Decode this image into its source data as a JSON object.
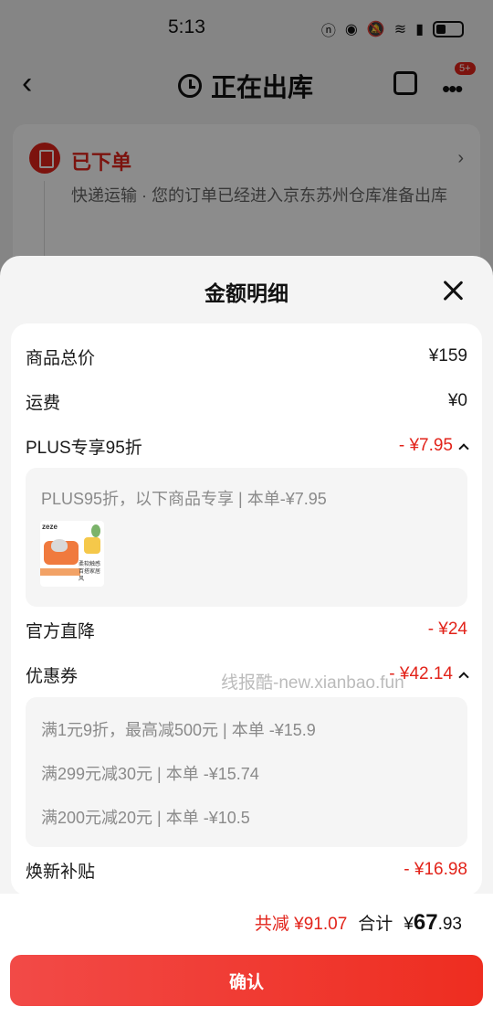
{
  "status_bar": {
    "time": "5:13",
    "icons": [
      "nfc-icon",
      "eye-icon",
      "mute-icon",
      "wifi-icon",
      "5g-signal-icon",
      "battery-icon"
    ]
  },
  "nav": {
    "title": "正在出库",
    "badge": "5+"
  },
  "order": {
    "status": "已下单",
    "description": "快递运输 · 您的订单已经进入京东苏州仓库准备出库"
  },
  "sheet": {
    "title": "金额明细",
    "rows": {
      "goods_total": {
        "label": "商品总价",
        "value": "¥159"
      },
      "shipping": {
        "label": "运费",
        "value": "¥0"
      },
      "plus": {
        "label": "PLUS专享95折",
        "value": "- ¥7.95"
      },
      "plus_detail": "PLUS95折，以下商品专享 | 本单-¥7.95",
      "official": {
        "label": "官方直降",
        "value": "- ¥24"
      },
      "coupon": {
        "label": "优惠券",
        "value": "- ¥42.14"
      },
      "coupon_details": [
        "满1元9折，最高减500元 | 本单 -¥15.9",
        "满299元减30元 | 本单 -¥15.74",
        "满200元减20元 | 本单 -¥10.5"
      ],
      "renew": {
        "label": "焕新补贴",
        "value": "- ¥16.98"
      }
    },
    "product_thumb": {
      "brand": "zeze",
      "caption": "柔软触感 百搭家居风"
    },
    "watermark": "线报酷-new.xianbao.fun"
  },
  "total": {
    "reduce": "共减 ¥91.07",
    "label": "合计",
    "currency": "¥",
    "integer": "67",
    "decimal": ".93"
  },
  "confirm_label": "确认",
  "colors": {
    "accent": "#e2231a",
    "button_start": "#f24a47",
    "button_end": "#ee2d20"
  }
}
